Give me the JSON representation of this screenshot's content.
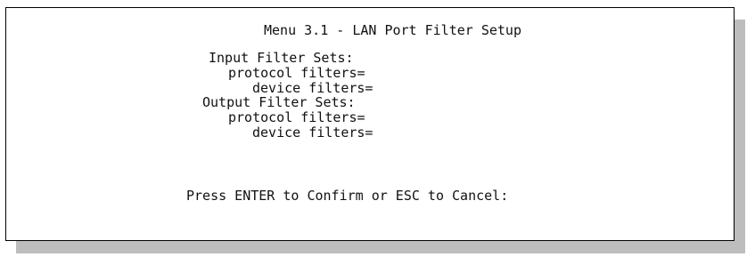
{
  "menu": {
    "title": "Menu 3.1 - LAN Port Filter Setup"
  },
  "input_filter_sets": {
    "heading": "Input Filter Sets:",
    "protocol_label": "protocol filters=",
    "protocol_value": "",
    "device_label": "device filters=",
    "device_value": ""
  },
  "output_filter_sets": {
    "heading": "Output Filter Sets:",
    "protocol_label": "protocol filters=",
    "protocol_value": "",
    "device_label": "device filters=",
    "device_value": ""
  },
  "footer": {
    "prompt": "Press ENTER to Confirm or ESC to Cancel:"
  }
}
